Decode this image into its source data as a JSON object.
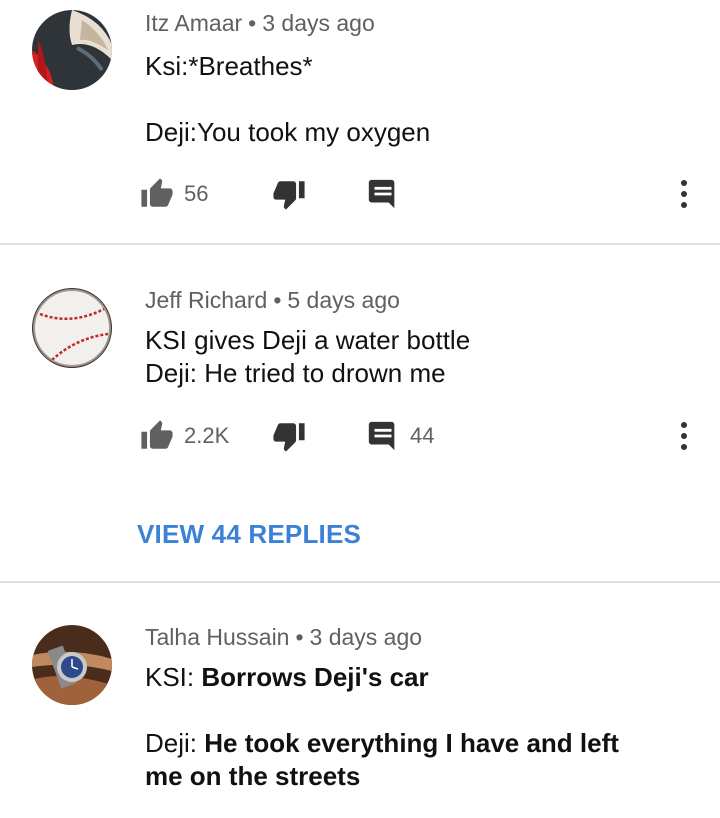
{
  "comments": [
    {
      "author": "Itz Amaar",
      "time": "3 days ago",
      "line1": "Ksi:*Breathes*",
      "line2": "Deji:You took my oxygen",
      "likes": "56",
      "replies": ""
    },
    {
      "author": "Jeff Richard",
      "time": "5 days ago",
      "line1": "KSI gives Deji a water bottle",
      "line2": "Deji: He tried to drown me",
      "likes": "2.2K",
      "replies": "44",
      "view_replies": "VIEW 44 REPLIES"
    },
    {
      "author": "Talha Hussain",
      "time": "3 days ago",
      "line1_prefix": "KSI: ",
      "line1_bold": "Borrows Deji's car",
      "line2_prefix": "Deji: ",
      "line2_bold": "He took everything I have and left me on the streets"
    }
  ],
  "separator": "•",
  "icons": {
    "like": "thumb-up-icon",
    "dislike": "thumb-down-icon",
    "reply": "reply-icon",
    "more": "more-vert-icon"
  },
  "colors": {
    "link": "#3b82d6",
    "meta": "#606060",
    "divider": "#e0e0e0"
  }
}
